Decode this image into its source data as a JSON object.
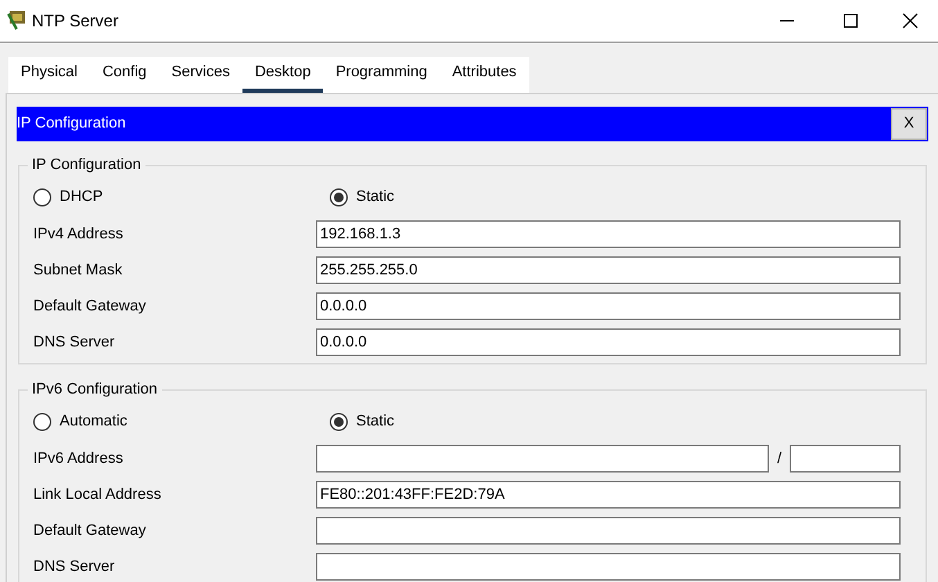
{
  "window": {
    "title": "NTP Server"
  },
  "tabs": [
    {
      "label": "Physical",
      "selected": false
    },
    {
      "label": "Config",
      "selected": false
    },
    {
      "label": "Services",
      "selected": false
    },
    {
      "label": "Desktop",
      "selected": true
    },
    {
      "label": "Programming",
      "selected": false
    },
    {
      "label": "Attributes",
      "selected": false
    }
  ],
  "panel": {
    "title": "IP Configuration",
    "close": "X"
  },
  "sections": [
    {
      "title": "IP Configuration",
      "modes": [
        {
          "label": "DHCP",
          "selected": false
        },
        {
          "label": "Static",
          "selected": true
        }
      ],
      "fields": [
        {
          "kind": "single",
          "label": "IPv4 Address",
          "value": "192.168.1.3"
        },
        {
          "kind": "single",
          "label": "Subnet Mask",
          "value": "255.255.255.0"
        },
        {
          "kind": "single",
          "label": "Default Gateway",
          "value": "0.0.0.0"
        },
        {
          "kind": "single",
          "label": "DNS Server",
          "value": "0.0.0.0"
        }
      ]
    },
    {
      "title": "IPv6 Configuration",
      "modes": [
        {
          "label": "Automatic",
          "selected": false
        },
        {
          "label": "Static",
          "selected": true
        }
      ],
      "fields": [
        {
          "kind": "prefix",
          "label": "IPv6 Address",
          "separator": "/"
        },
        {
          "kind": "single",
          "label": "Link Local Address",
          "value": "FE80::201:43FF:FE2D:79A"
        },
        {
          "kind": "single",
          "label": "Default Gateway"
        },
        {
          "kind": "single",
          "label": "DNS Server"
        }
      ]
    }
  ]
}
